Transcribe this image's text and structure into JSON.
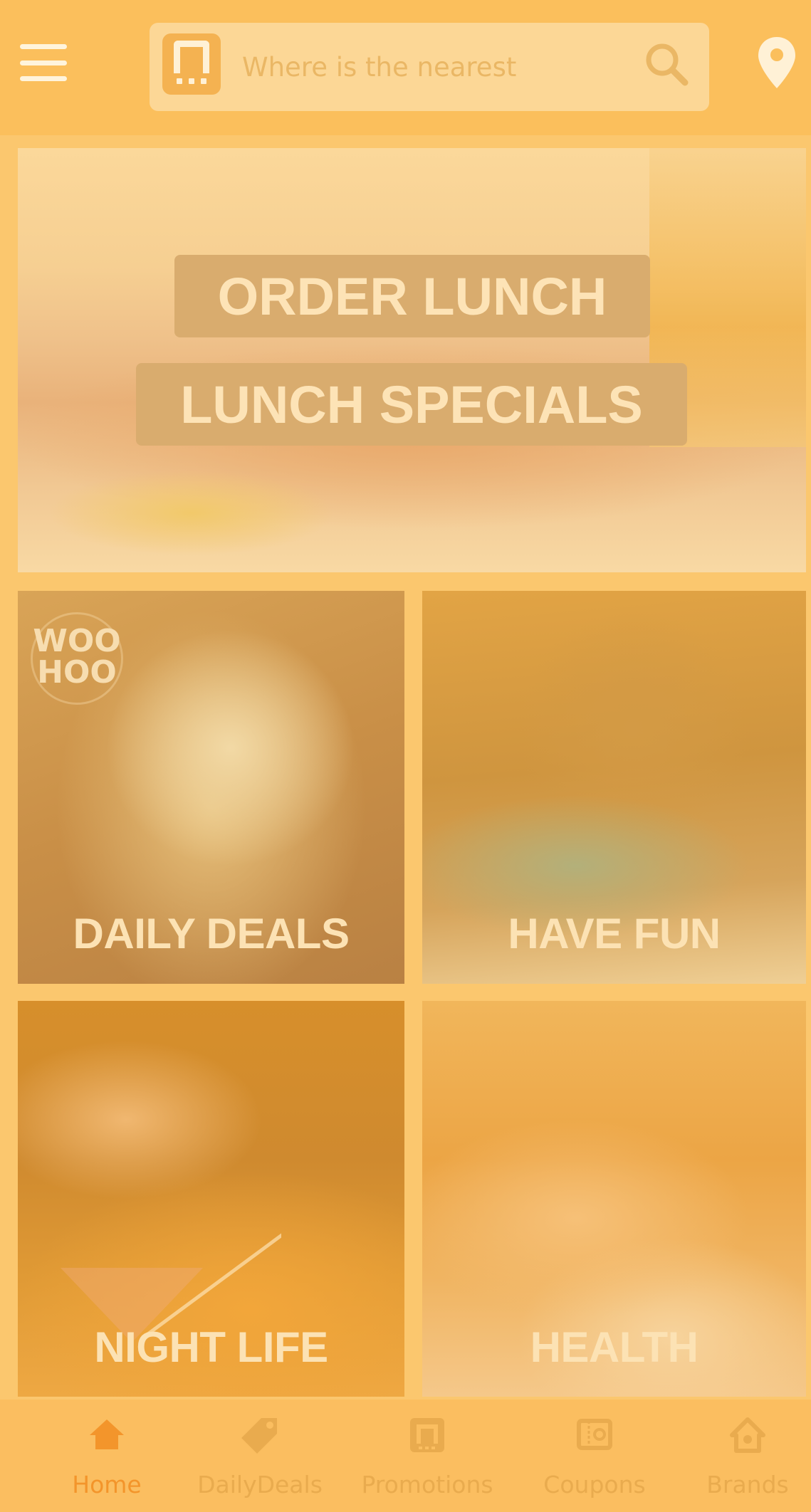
{
  "colors": {
    "header_bg": "#fbbf5c",
    "accent_active": "#f3952b",
    "tab_inactive": "#e9ab4e",
    "tile_label": "#fce2b4"
  },
  "header": {
    "menu_icon": "hamburger-menu-icon",
    "search": {
      "placeholder": "Where is the nearest",
      "value": ""
    },
    "search_icon": "search-icon",
    "location_icon": "map-pin-icon"
  },
  "hero": {
    "line1": "ORDER LUNCH",
    "line2": "LUNCH SPECIALS"
  },
  "tiles": [
    {
      "label": "DAILY DEALS"
    },
    {
      "label": "HAVE FUN"
    },
    {
      "label": "NIGHT LIFE"
    },
    {
      "label": "HEALTH"
    }
  ],
  "deals_badge": {
    "line1": "WOO",
    "line2": "HOO"
  },
  "tabbar": {
    "items": [
      {
        "label": "Home",
        "icon": "home-icon",
        "active": true
      },
      {
        "label": "DailyDeals",
        "icon": "tag-icon",
        "active": false
      },
      {
        "label": "Promotions",
        "icon": "promotions-logo-icon",
        "active": false
      },
      {
        "label": "Coupons",
        "icon": "coupon-icon",
        "active": false
      },
      {
        "label": "Brands",
        "icon": "brands-icon",
        "active": false
      }
    ]
  }
}
